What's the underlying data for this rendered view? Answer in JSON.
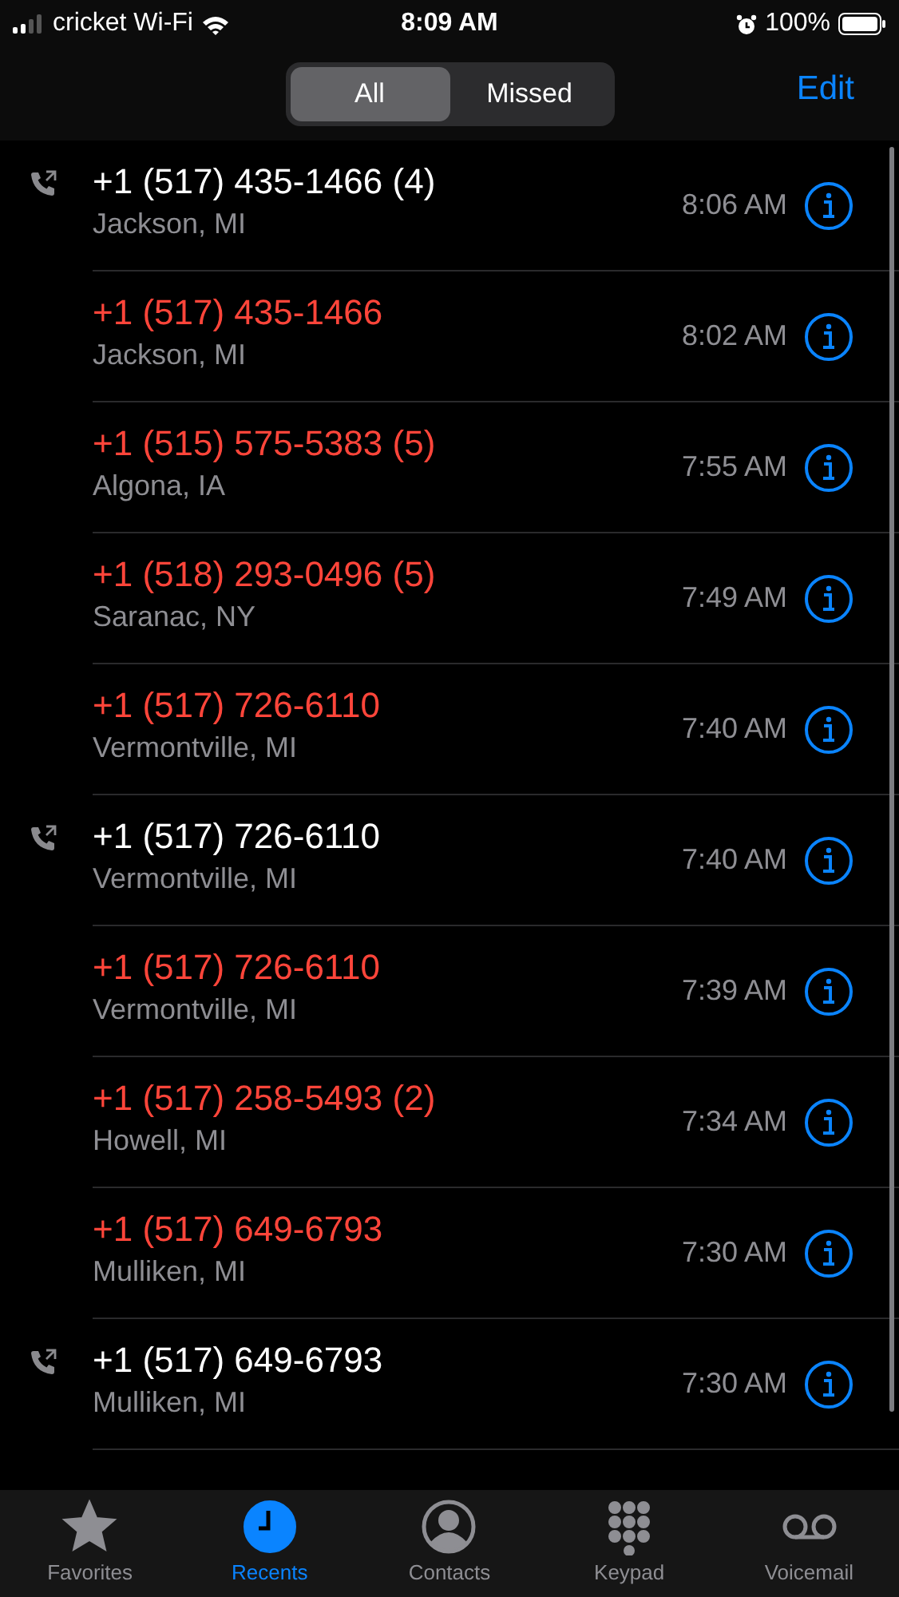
{
  "status_bar": {
    "carrier": "cricket Wi-Fi",
    "time": "8:09 AM",
    "battery": "100%"
  },
  "segments": [
    {
      "label": "All",
      "selected": true
    },
    {
      "label": "Missed",
      "selected": false
    }
  ],
  "edit_button": "Edit",
  "calls": [
    {
      "number": "+1 (517) 435-1466 (4)",
      "location": "Jackson, MI",
      "time": "8:06 AM",
      "missed": false,
      "outgoing": true
    },
    {
      "number": "+1 (517) 435-1466",
      "location": "Jackson, MI",
      "time": "8:02 AM",
      "missed": true,
      "outgoing": false
    },
    {
      "number": "+1 (515) 575-5383 (5)",
      "location": "Algona, IA",
      "time": "7:55 AM",
      "missed": true,
      "outgoing": false
    },
    {
      "number": "+1 (518) 293-0496 (5)",
      "location": "Saranac, NY",
      "time": "7:49 AM",
      "missed": true,
      "outgoing": false
    },
    {
      "number": "+1 (517) 726-6110",
      "location": "Vermontville, MI",
      "time": "7:40 AM",
      "missed": true,
      "outgoing": false
    },
    {
      "number": "+1 (517) 726-6110",
      "location": "Vermontville, MI",
      "time": "7:40 AM",
      "missed": false,
      "outgoing": true
    },
    {
      "number": "+1 (517) 726-6110",
      "location": "Vermontville, MI",
      "time": "7:39 AM",
      "missed": true,
      "outgoing": false
    },
    {
      "number": "+1 (517) 258-5493 (2)",
      "location": "Howell, MI",
      "time": "7:34 AM",
      "missed": true,
      "outgoing": false
    },
    {
      "number": "+1 (517) 649-6793",
      "location": "Mulliken, MI",
      "time": "7:30 AM",
      "missed": true,
      "outgoing": false
    },
    {
      "number": "+1 (517) 649-6793",
      "location": "Mulliken, MI",
      "time": "7:30 AM",
      "missed": false,
      "outgoing": true
    }
  ],
  "tab_bar": [
    {
      "label": "Favorites",
      "kind": "star",
      "selected": false
    },
    {
      "label": "Recents",
      "kind": "clock",
      "selected": true
    },
    {
      "label": "Contacts",
      "kind": "person",
      "selected": false
    },
    {
      "label": "Keypad",
      "kind": "keypad",
      "selected": false
    },
    {
      "label": "Voicemail",
      "kind": "voicemail",
      "selected": false
    }
  ]
}
